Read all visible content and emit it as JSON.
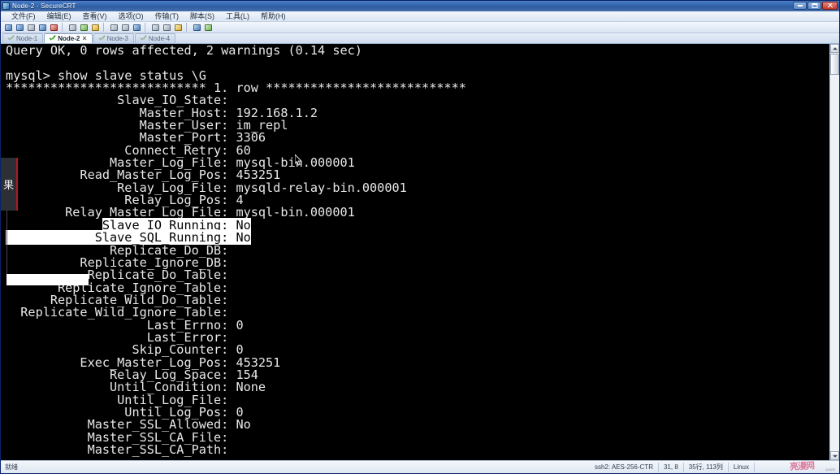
{
  "window": {
    "title": "Node-2 - SecureCRT",
    "icon": "securecrt-icon",
    "minimize_label": "–",
    "maximize_label": "□",
    "close_label": "✕"
  },
  "menubar": {
    "items": [
      {
        "label": "文件(F)",
        "name": "menu-file"
      },
      {
        "label": "编辑(E)",
        "name": "menu-edit"
      },
      {
        "label": "查看(V)",
        "name": "menu-view"
      },
      {
        "label": "选项(O)",
        "name": "menu-options"
      },
      {
        "label": "传输(T)",
        "name": "menu-transfer"
      },
      {
        "label": "脚本(S)",
        "name": "menu-script"
      },
      {
        "label": "工具(L)",
        "name": "menu-tools"
      },
      {
        "label": "帮助(H)",
        "name": "menu-help"
      }
    ]
  },
  "toolbar": {
    "icons": [
      "new-session-icon",
      "quick-connect-icon",
      "clone-session-icon",
      "connect-icon",
      "disconnect-icon",
      "copy-icon",
      "paste-icon",
      "find-icon",
      "print-icon",
      "print-selection-icon",
      "log-session-icon",
      "transfer-icon",
      "session-options-icon",
      "global-options-icon",
      "chat-window-icon",
      "help-icon"
    ]
  },
  "tabs": {
    "items": [
      {
        "label": "Node-1",
        "active": false,
        "closable": false
      },
      {
        "label": "Node-2",
        "active": true,
        "closable": true,
        "close_label": "×"
      },
      {
        "label": "Node-3",
        "active": false,
        "closable": false
      },
      {
        "label": "Node-4",
        "active": false,
        "closable": false
      }
    ]
  },
  "terminal": {
    "lines": [
      {
        "text": "Query OK, 0 rows affected, 2 warnings (0.14 sec)"
      },
      {
        "text": ""
      },
      {
        "text": "mysql> show slave status \\G"
      },
      {
        "text": "*************************** 1. row ***************************"
      },
      {
        "text": "               Slave_IO_State: "
      },
      {
        "text": "                  Master_Host: 192.168.1.2"
      },
      {
        "text": "                  Master_User: im_repl"
      },
      {
        "text": "                  Master_Port: 3306"
      },
      {
        "text": "                Connect_Retry: 60"
      },
      {
        "text": "              Master_Log_File: mysql-bin.000001"
      },
      {
        "text": "          Read_Master_Log_Pos: 453251"
      },
      {
        "text": "               Relay_Log_File: mysqld-relay-bin.000001"
      },
      {
        "text": "                Relay_Log_Pos: 4"
      },
      {
        "text": "        Relay_Master_Log_File: mysql-bin.000001"
      },
      {
        "text": "             Slave_IO_Running: No",
        "selection": [
          13,
          40
        ]
      },
      {
        "text": "            Slave_SQL_Running: No",
        "selection": [
          0,
          40
        ]
      },
      {
        "text": "              Replicate_Do_DB: "
      },
      {
        "text": "          Replicate_Ignore_DB: "
      },
      {
        "text": "           Replicate_Do_Table: "
      },
      {
        "text": "       Replicate_Ignore_Table: "
      },
      {
        "text": "      Replicate_Wild_Do_Table: "
      },
      {
        "text": "  Replicate_Wild_Ignore_Table: "
      },
      {
        "text": "                   Last_Errno: 0"
      },
      {
        "text": "                   Last_Error: "
      },
      {
        "text": "                 Skip_Counter: 0"
      },
      {
        "text": "          Exec_Master_Log_Pos: 453251"
      },
      {
        "text": "              Relay_Log_Space: 154"
      },
      {
        "text": "              Until_Condition: None"
      },
      {
        "text": "               Until_Log_File: "
      },
      {
        "text": "                Until_Log_Pos: 0"
      },
      {
        "text": "           Master_SSL_Allowed: No"
      },
      {
        "text": "           Master_SSL_CA_File: "
      },
      {
        "text": "           Master_SSL_CA_Path: "
      }
    ]
  },
  "overlay": {
    "label": "果"
  },
  "statusbar": {
    "ready": "就绪",
    "protocol": "ssh2: AES-256-CTR",
    "cursor_pos": "31, 8",
    "size": "35行, 113列",
    "emulation": "Linux",
    "watermark": "亮漫网",
    "watermark_sub": "www"
  },
  "colors": {
    "terminal_bg": "#000000",
    "terminal_fg": "#e8e8e8",
    "selection_bg": "#ffffff",
    "selection_fg": "#000000",
    "accent": "#3264ab",
    "overlay_accent": "#b3161e"
  }
}
